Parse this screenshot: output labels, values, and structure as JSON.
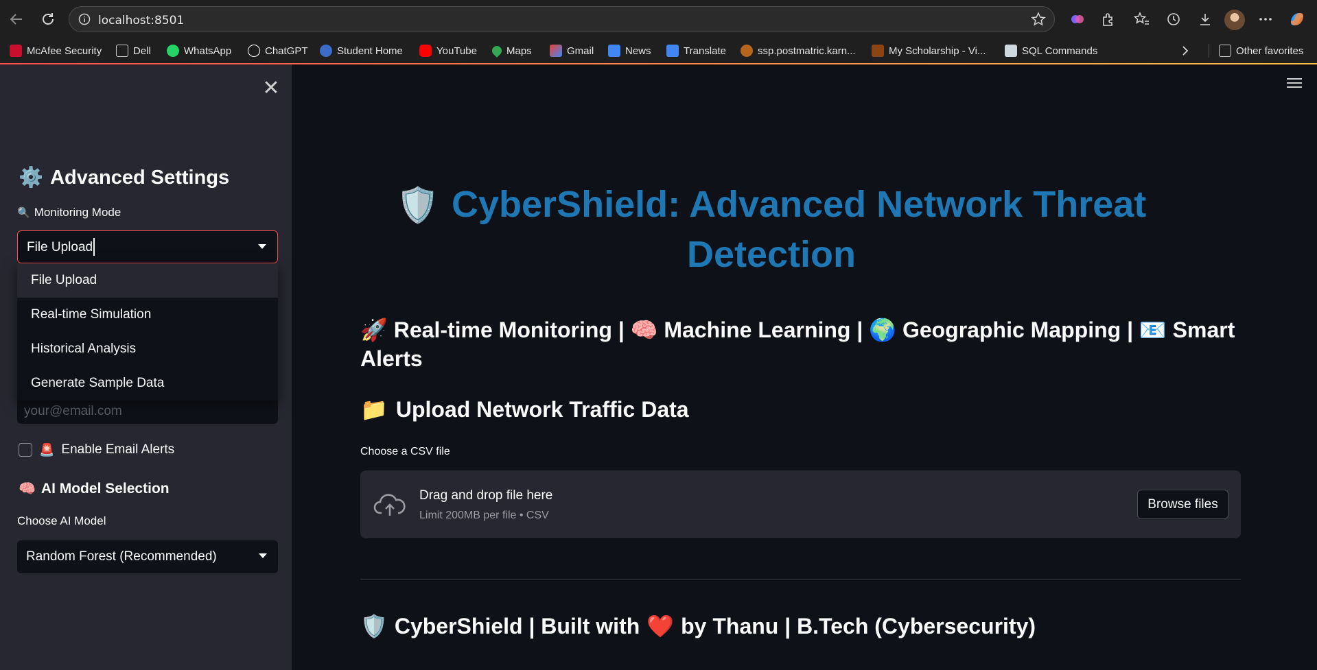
{
  "browser": {
    "url": "localhost:8501",
    "bookmarks": [
      {
        "label": "McAfee Security",
        "color": "#c8102e"
      },
      {
        "label": "Dell",
        "color": "folder"
      },
      {
        "label": "WhatsApp",
        "color": "#25d366"
      },
      {
        "label": "ChatGPT",
        "color": "#ffffff"
      },
      {
        "label": "Student Home",
        "color": "#3c6cc7"
      },
      {
        "label": "YouTube",
        "color": "#ff0000"
      },
      {
        "label": "Maps",
        "color": "#34a853"
      },
      {
        "label": "Gmail",
        "color": "#ea4335"
      },
      {
        "label": "News",
        "color": "#4285f4"
      },
      {
        "label": "Translate",
        "color": "#4285f4"
      },
      {
        "label": "ssp.postmatric.karn...",
        "color": "#b5651d"
      },
      {
        "label": "My Scholarship - Vi...",
        "color": "#8b4513"
      },
      {
        "label": "SQL Commands",
        "color": "#cfd8dc"
      }
    ],
    "other_favorites": "Other favorites"
  },
  "sidebar": {
    "header": "Advanced Settings",
    "monitoring_label": "Monitoring Mode",
    "monitoring_value": "File Upload",
    "monitoring_options": [
      "File Upload",
      "Real-time Simulation",
      "Historical Analysis",
      "Generate Sample Data"
    ],
    "email_placeholder": "your@email.com",
    "email_alerts_label": "Enable Email Alerts",
    "ai_header": "AI Model Selection",
    "model_label": "Choose AI Model",
    "model_value": "Random Forest (Recommended)"
  },
  "main": {
    "title": "CyberShield: Advanced Network Threat Detection",
    "subtitle_parts": [
      "Real-time Monitoring |",
      "Machine Learning |",
      "Geographic Mapping |",
      "Smart Alerts"
    ],
    "upload_header": "Upload Network Traffic Data",
    "file_label": "Choose a CSV file",
    "drag_text": "Drag and drop file here",
    "limit_text": "Limit 200MB per file • CSV",
    "browse_label": "Browse files",
    "footer_parts": [
      "CyberShield | Built with",
      "by Thanu | B.Tech (Cybersecurity)"
    ]
  },
  "colors": {
    "accent": "#ff4b4b",
    "title_blue": "#1f77b4",
    "sidebar_bg": "#262730",
    "main_bg": "#0e1117"
  },
  "icons": [
    "gear-icon",
    "magnifier-icon",
    "rocket-icon",
    "brain-icon",
    "globe-icon",
    "envelope-icon",
    "folder-icon",
    "shield-icon",
    "siren-icon",
    "heart-icon",
    "cloud-upload-icon"
  ]
}
